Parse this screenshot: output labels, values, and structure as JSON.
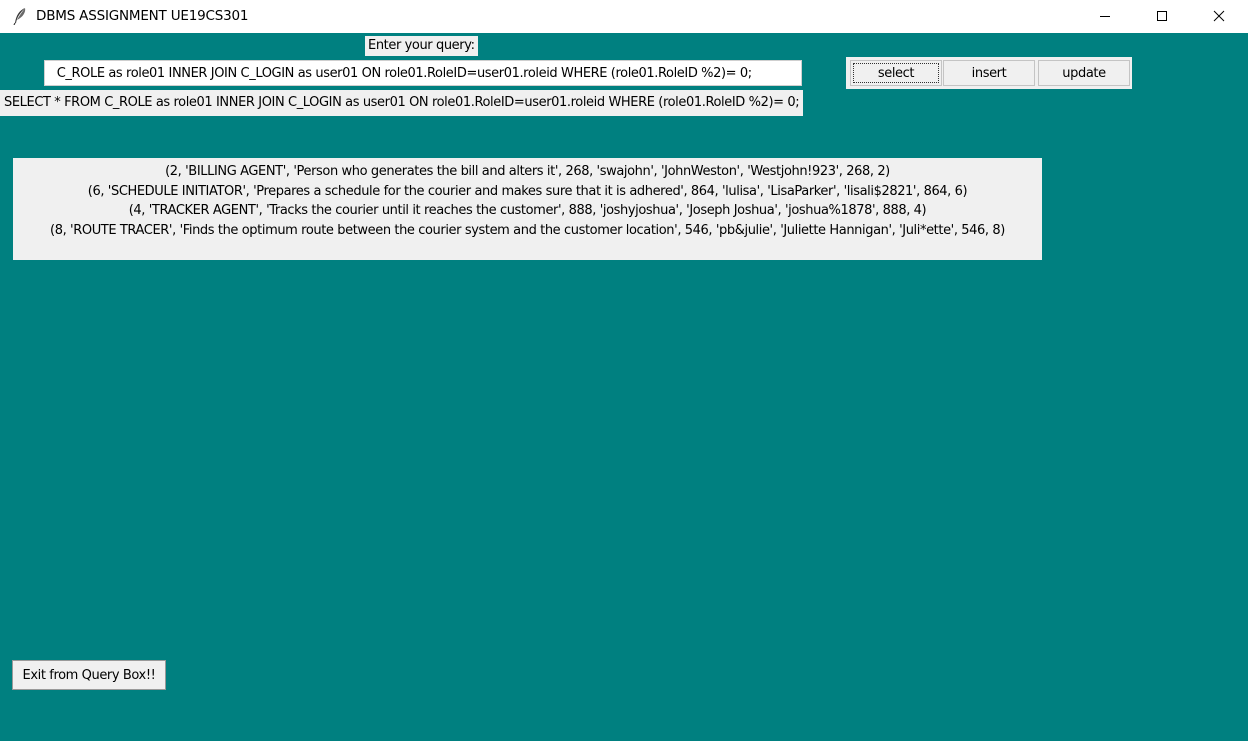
{
  "window": {
    "title": "DBMS ASSIGNMENT UE19CS301",
    "icon": "feather-icon",
    "controls": [
      "minimize-icon",
      "maximize-icon",
      "close-icon"
    ],
    "background_color": "#008080"
  },
  "query": {
    "prompt_label": "Enter your query:",
    "input_value": " C_ROLE as role01 INNER JOIN C_LOGIN as user01 ON role01.RoleID=user01.roleid WHERE (role01.RoleID %2)= 0;",
    "echo_text": "SELECT * FROM C_ROLE as role01 INNER JOIN C_LOGIN as user01 ON role01.RoleID=user01.roleid WHERE (role01.RoleID %2)= 0;"
  },
  "buttons": {
    "select": "select",
    "insert": "insert",
    "update": "update",
    "exit": "Exit from Query Box!!"
  },
  "results": [
    "(2, 'BILLING AGENT', 'Person who generates the bill and alters it', 268, 'swajohn', 'JohnWeston', 'Westjohn!923', 268, 2)",
    "(6, 'SCHEDULE INITIATOR', 'Prepares a schedule for the courier and makes sure that it is adhered', 864, 'lulisa', 'LisaParker', 'lisali$2821', 864, 6)",
    "(4, 'TRACKER AGENT', 'Tracks the courier until it reaches the customer', 888, 'joshyjoshua', 'Joseph Joshua', 'joshua%1878', 888, 4)",
    "(8, 'ROUTE TRACER', 'Finds the optimum route between the courier system and the customer location', 546, 'pb&julie', 'Juliette Hannigan', 'Juli*ette', 546, 8)"
  ]
}
